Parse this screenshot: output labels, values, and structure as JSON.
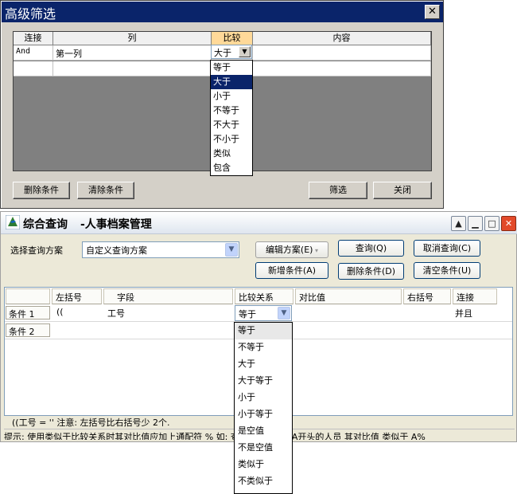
{
  "filter_dialog": {
    "title": "高级筛选",
    "close_label": "✕",
    "columns": [
      "连接",
      "列",
      "比较",
      "内容"
    ],
    "rows": [
      {
        "connect": "And",
        "column": "第一列",
        "compare": "大于",
        "content": ""
      },
      {
        "connect": "",
        "column": "",
        "compare": "",
        "content": ""
      }
    ],
    "compare_options": [
      "等于",
      "大于",
      "小于",
      "不等于",
      "不大于",
      "不小于",
      "类似",
      "包含"
    ],
    "compare_selected": "大于",
    "buttons": {
      "delete": "删除条件",
      "clear": "清除条件",
      "filter": "筛选",
      "close": "关闭"
    }
  },
  "query_dialog": {
    "title_main": "综合查询",
    "title_sub": "-人事档案管理",
    "scheme_label": "选择查询方案",
    "scheme_value": "自定义查询方案",
    "buttons": {
      "edit_scheme": "编辑方案(E)",
      "query": "查询(Q)",
      "cancel_query": "取消查询(C)",
      "add_condition": "新增条件(A)",
      "delete_condition": "删除条件(D)",
      "clear_condition": "清空条件(U)"
    },
    "columns": [
      "",
      "左括号",
      "字段",
      "比较关系",
      "对比值",
      "右括号",
      "连接"
    ],
    "rows": [
      {
        "label": "条件 1",
        "left_paren": "((",
        "field": "工号",
        "compare": "等于",
        "value": "",
        "right_paren": "",
        "connect": "并且"
      },
      {
        "label": "条件 2",
        "left_paren": "",
        "field": "",
        "compare": "",
        "value": "",
        "right_paren": "",
        "connect": ""
      }
    ],
    "compare_options": [
      "等于",
      "不等于",
      "大于",
      "大于等于",
      "小于",
      "小于等于",
      "是空值",
      "不是空值",
      "类似于",
      "不类似于"
    ],
    "status_expression": "((工号 = ''  注意: 左括号比右括号少 2个.",
    "hint": "提示: 使用类似于比较关系时其对比值应加上通配符 %  如: 查找工号以字母A开头的人员 其对比值 类似于  A%"
  }
}
